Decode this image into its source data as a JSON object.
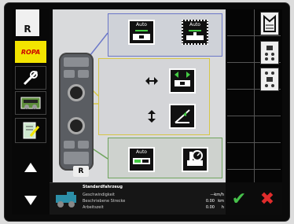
{
  "header": {
    "mode_letter": "R"
  },
  "brand": {
    "label": "ROPA"
  },
  "frames": {
    "blue": {
      "btn1": "Auto",
      "btn2": "Auto"
    },
    "yellow": {},
    "green": {
      "btn1": "Auto"
    }
  },
  "remote": {
    "plate": "R"
  },
  "status": {
    "title": "Standardfahrzeug",
    "rows": [
      {
        "label": "Geschwindigkeit",
        "value": "---",
        "unit": "km/h"
      },
      {
        "label": "Beschriebene Strecke",
        "value": "0.00",
        "unit": "km"
      },
      {
        "label": "Arbeitszeit",
        "value": "0.00",
        "unit": "h"
      }
    ]
  },
  "actions": {
    "ok": "✔",
    "cancel": "✖"
  },
  "icons": {
    "tool": "wrench-icon",
    "up": "up-arrow-icon",
    "down": "down-arrow-icon"
  },
  "colors": {
    "brand_yellow": "#f3e400",
    "ok_green": "#46c04a",
    "cancel_red": "#e02c2c"
  }
}
